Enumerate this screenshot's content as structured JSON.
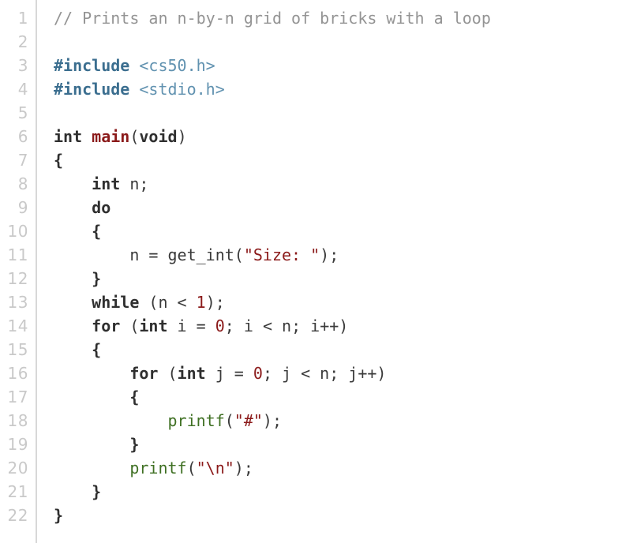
{
  "editor": {
    "language": "c",
    "total_lines": 22,
    "gutter": {
      "numbers": [
        "1",
        "2",
        "3",
        "4",
        "5",
        "6",
        "7",
        "8",
        "9",
        "10",
        "11",
        "12",
        "13",
        "14",
        "15",
        "16",
        "17",
        "18",
        "19",
        "20",
        "21",
        "22"
      ],
      "number_color": "#c9c9c9",
      "separator_color": "#d8d8d8"
    },
    "theme": {
      "background": "#ffffff",
      "plain": "#3a3a3a",
      "comment": "#949494",
      "preprocessor": "#3b6e8f",
      "header_name": "#6192b0",
      "keyword": "#2f2f2f",
      "function_definition": "#8b1a1a",
      "function_call": "#3f7023",
      "string": "#8b1a1a",
      "number": "#8b1a1a"
    },
    "lines": [
      {
        "number": "1",
        "text": "// Prints an n-by-n grid of bricks with a loop",
        "tokens": [
          {
            "t": "// Prints an n-by-n grid of bricks with a loop",
            "c": "comment"
          }
        ]
      },
      {
        "number": "2",
        "text": "",
        "tokens": []
      },
      {
        "number": "3",
        "text": "#include <cs50.h>",
        "tokens": [
          {
            "t": "#include",
            "c": "preproc"
          },
          {
            "t": " ",
            "c": "plain"
          },
          {
            "t": "<cs50.h>",
            "c": "header"
          }
        ]
      },
      {
        "number": "4",
        "text": "#include <stdio.h>",
        "tokens": [
          {
            "t": "#include",
            "c": "preproc"
          },
          {
            "t": " ",
            "c": "plain"
          },
          {
            "t": "<stdio.h>",
            "c": "header"
          }
        ]
      },
      {
        "number": "5",
        "text": "",
        "tokens": []
      },
      {
        "number": "6",
        "text": "int main(void)",
        "tokens": [
          {
            "t": "int",
            "c": "keyword"
          },
          {
            "t": " ",
            "c": "plain"
          },
          {
            "t": "main",
            "c": "funcdef"
          },
          {
            "t": "(",
            "c": "punct"
          },
          {
            "t": "void",
            "c": "keyword"
          },
          {
            "t": ")",
            "c": "punct"
          }
        ]
      },
      {
        "number": "7",
        "text": "{",
        "tokens": [
          {
            "t": "{",
            "c": "brace"
          }
        ]
      },
      {
        "number": "8",
        "text": "    int n;",
        "tokens": [
          {
            "t": "    ",
            "c": "plain"
          },
          {
            "t": "int",
            "c": "keyword"
          },
          {
            "t": " n;",
            "c": "plain"
          }
        ]
      },
      {
        "number": "9",
        "text": "    do",
        "tokens": [
          {
            "t": "    ",
            "c": "plain"
          },
          {
            "t": "do",
            "c": "keyword"
          }
        ]
      },
      {
        "number": "10",
        "text": "    {",
        "tokens": [
          {
            "t": "    ",
            "c": "plain"
          },
          {
            "t": "{",
            "c": "brace"
          }
        ]
      },
      {
        "number": "11",
        "text": "        n = get_int(\"Size: \");",
        "tokens": [
          {
            "t": "        n = get_int(",
            "c": "plain"
          },
          {
            "t": "\"Size: \"",
            "c": "string"
          },
          {
            "t": ");",
            "c": "plain"
          }
        ]
      },
      {
        "number": "12",
        "text": "    }",
        "tokens": [
          {
            "t": "    ",
            "c": "plain"
          },
          {
            "t": "}",
            "c": "brace"
          }
        ]
      },
      {
        "number": "13",
        "text": "    while (n < 1);",
        "tokens": [
          {
            "t": "    ",
            "c": "plain"
          },
          {
            "t": "while",
            "c": "keyword"
          },
          {
            "t": " (n < ",
            "c": "plain"
          },
          {
            "t": "1",
            "c": "number"
          },
          {
            "t": ");",
            "c": "plain"
          }
        ]
      },
      {
        "number": "14",
        "text": "    for (int i = 0; i < n; i++)",
        "tokens": [
          {
            "t": "    ",
            "c": "plain"
          },
          {
            "t": "for",
            "c": "keyword"
          },
          {
            "t": " (",
            "c": "plain"
          },
          {
            "t": "int",
            "c": "keyword"
          },
          {
            "t": " i = ",
            "c": "plain"
          },
          {
            "t": "0",
            "c": "number"
          },
          {
            "t": "; i < n; i++)",
            "c": "plain"
          }
        ]
      },
      {
        "number": "15",
        "text": "    {",
        "tokens": [
          {
            "t": "    ",
            "c": "plain"
          },
          {
            "t": "{",
            "c": "brace"
          }
        ]
      },
      {
        "number": "16",
        "text": "        for (int j = 0; j < n; j++)",
        "tokens": [
          {
            "t": "        ",
            "c": "plain"
          },
          {
            "t": "for",
            "c": "keyword"
          },
          {
            "t": " (",
            "c": "plain"
          },
          {
            "t": "int",
            "c": "keyword"
          },
          {
            "t": " j = ",
            "c": "plain"
          },
          {
            "t": "0",
            "c": "number"
          },
          {
            "t": "; j < n; j++)",
            "c": "plain"
          }
        ]
      },
      {
        "number": "17",
        "text": "        {",
        "tokens": [
          {
            "t": "        ",
            "c": "plain"
          },
          {
            "t": "{",
            "c": "brace"
          }
        ]
      },
      {
        "number": "18",
        "text": "            printf(\"#\");",
        "tokens": [
          {
            "t": "            ",
            "c": "plain"
          },
          {
            "t": "printf",
            "c": "function"
          },
          {
            "t": "(",
            "c": "plain"
          },
          {
            "t": "\"#\"",
            "c": "string"
          },
          {
            "t": ");",
            "c": "plain"
          }
        ]
      },
      {
        "number": "19",
        "text": "        }",
        "tokens": [
          {
            "t": "        ",
            "c": "plain"
          },
          {
            "t": "}",
            "c": "brace"
          }
        ]
      },
      {
        "number": "20",
        "text": "        printf(\"\\n\");",
        "tokens": [
          {
            "t": "        ",
            "c": "plain"
          },
          {
            "t": "printf",
            "c": "function"
          },
          {
            "t": "(",
            "c": "plain"
          },
          {
            "t": "\"\\n\"",
            "c": "string"
          },
          {
            "t": ");",
            "c": "plain"
          }
        ]
      },
      {
        "number": "21",
        "text": "    }",
        "tokens": [
          {
            "t": "    ",
            "c": "plain"
          },
          {
            "t": "}",
            "c": "brace"
          }
        ]
      },
      {
        "number": "22",
        "text": "}",
        "tokens": [
          {
            "t": "}",
            "c": "brace"
          }
        ]
      }
    ]
  }
}
